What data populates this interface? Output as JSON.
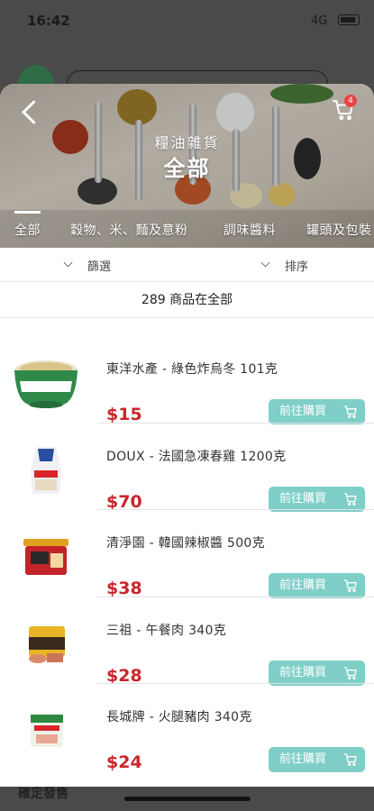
{
  "status_bar": {
    "time": "16:42",
    "network": "4G"
  },
  "background": {
    "bottom_text": "確定發售"
  },
  "header": {
    "subtitle": "糧油雜貨",
    "title": "全部",
    "cart_count": "4"
  },
  "tabs": [
    {
      "label": "全部",
      "active": true
    },
    {
      "label": "穀物、米、麵及意粉",
      "active": false
    },
    {
      "label": "調味醬料",
      "active": false
    },
    {
      "label": "罐頭及包裝",
      "active": false
    }
  ],
  "filter": {
    "filter_label": "篩選",
    "sort_label": "排序"
  },
  "count_text": "289 商品在全部",
  "products": [
    {
      "name": "東洋水產 - 綠色炸烏冬 101克",
      "price": "$15",
      "button": "前往購買"
    },
    {
      "name": "DOUX - 法國急凍春雞 1200克",
      "price": "$70",
      "button": "前往購買"
    },
    {
      "name": "清淨園 - 韓國辣椒醬 500克",
      "price": "$38",
      "button": "前往購買"
    },
    {
      "name": "三祖 - 午餐肉 340克",
      "price": "$28",
      "button": "前往購買"
    },
    {
      "name": "長城牌 - 火腿豬肉 340克",
      "price": "$24",
      "button": "前往購買"
    }
  ],
  "colors": {
    "accent": "#7fcfc8",
    "price": "#c9272d",
    "badge": "#e84545"
  }
}
